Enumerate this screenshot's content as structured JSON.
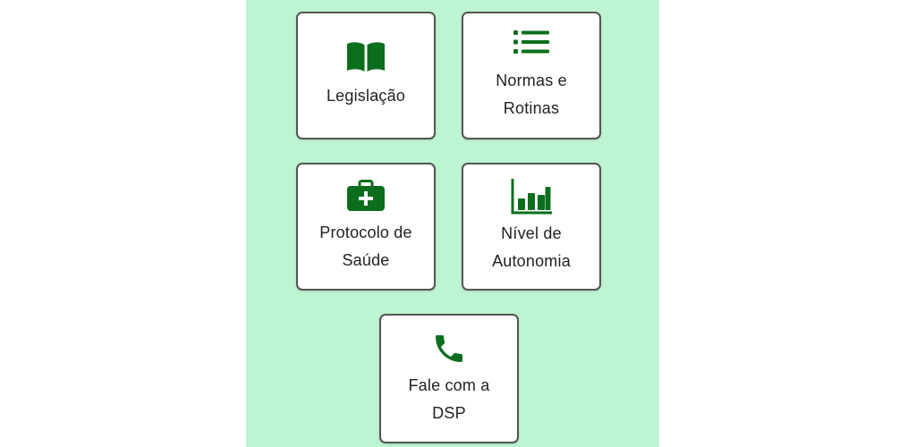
{
  "theme": {
    "background": "#bdf4d1",
    "tile_background": "#ffffff",
    "icon_color": "#0b6e1d",
    "text_color": "#222222"
  },
  "menu": {
    "legislacao": {
      "line1": "Legislação",
      "line2": "",
      "icon": "book-icon"
    },
    "normas": {
      "line1": "Normas e",
      "line2": "Rotinas",
      "icon": "list-icon"
    },
    "protocolo": {
      "line1": "Protocolo de",
      "line2": "Saúde",
      "icon": "medical-kit-icon"
    },
    "nivel": {
      "line1": "Nível de",
      "line2": "Autonomia",
      "icon": "bar-chart-icon"
    },
    "fale": {
      "line1": "Fale com a",
      "line2": "DSP",
      "icon": "phone-icon"
    }
  }
}
